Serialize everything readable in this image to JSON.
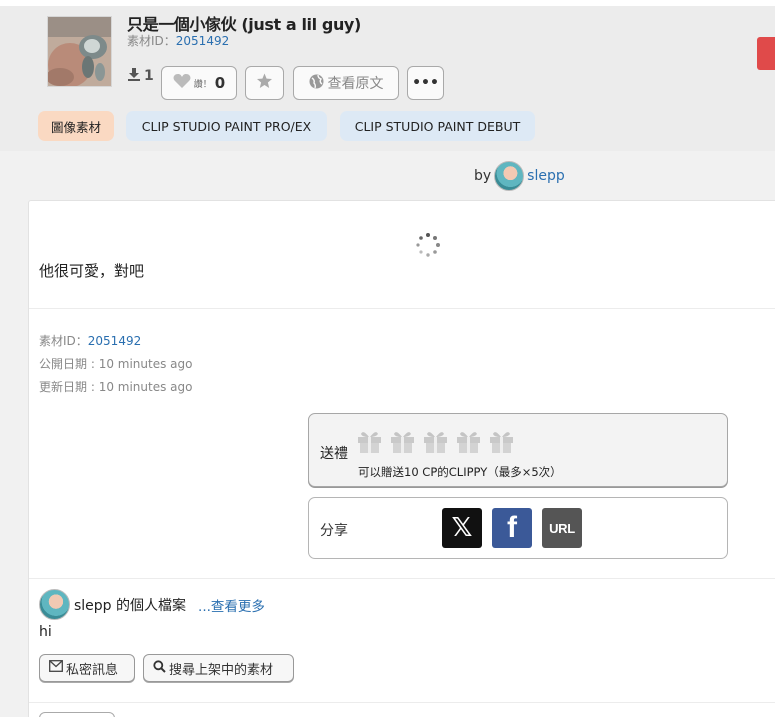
{
  "material": {
    "title": "只是一個小傢伙 (just a lil guy)",
    "id_label": "素材ID：",
    "id_value": "2051492",
    "download_count": "1",
    "like_small": "讚！",
    "like_count": "0",
    "view_original": "查看原文",
    "more_label": "•••"
  },
  "tags": [
    "圖像素材",
    "CLIP STUDIO PAINT PRO/EX",
    "CLIP STUDIO PAINT DEBUT"
  ],
  "author": {
    "by": "by",
    "name": "slepp"
  },
  "description": "他很可愛，對吧",
  "meta": {
    "id_label": "素材ID：",
    "id_value": "2051492",
    "published_label": "公開日期 : ",
    "published_value": "10 minutes ago",
    "updated_label": "更新日期 : ",
    "updated_value": "10 minutes ago"
  },
  "gift": {
    "label": "送禮",
    "note": "可以贈送10 CP的CLIPPY（最多×5次）"
  },
  "share": {
    "label": "分享",
    "x_label": "𝕏",
    "fb_label": "f",
    "url_label": "URL"
  },
  "profile": {
    "name_label": "slepp 的個人檔案",
    "more_link": "...查看更多",
    "bio": "hi",
    "pm_button": "私密訊息",
    "search_button": "搜尋上架中的素材"
  },
  "colors": {
    "accent_link": "#2a6fb0",
    "tag_orange": "#fad9c2",
    "tag_blue": "#dde9f5",
    "brand_red": "#e04a4a",
    "facebook": "#3b5998"
  }
}
